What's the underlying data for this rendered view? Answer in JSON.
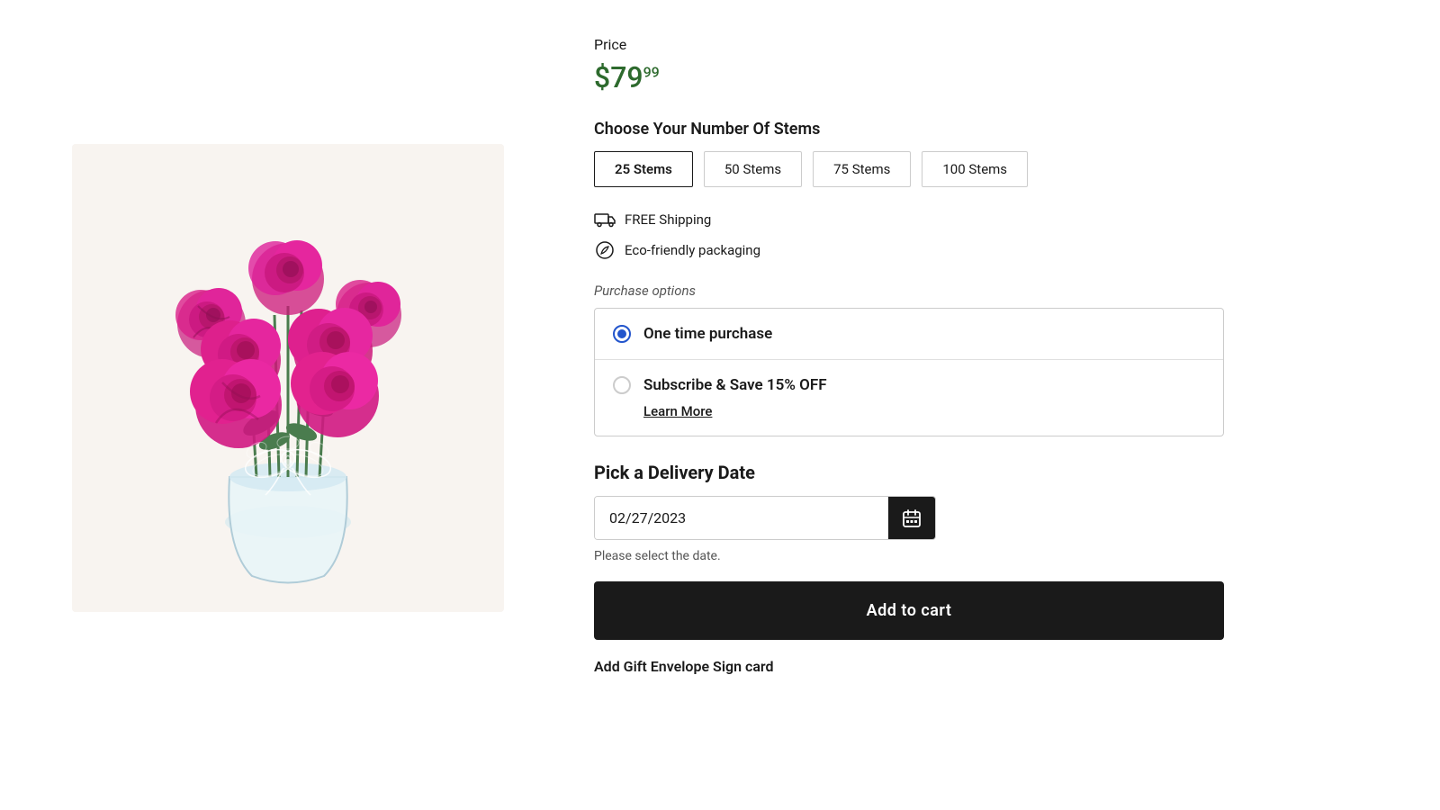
{
  "product": {
    "price_label": "Price",
    "price_main": "$79",
    "price_cents": "99",
    "price_color": "#2d6a2d"
  },
  "stems": {
    "section_title": "Choose Your Number Of Stems",
    "options": [
      {
        "label": "25 Stems",
        "selected": true
      },
      {
        "label": "50 Stems",
        "selected": false
      },
      {
        "label": "75 Stems",
        "selected": false
      },
      {
        "label": "100 Stems",
        "selected": false
      }
    ]
  },
  "perks": [
    {
      "icon": "🚚",
      "text": "FREE Shipping"
    },
    {
      "icon": "♻️",
      "text": "Eco-friendly packaging"
    }
  ],
  "purchase_options": {
    "label": "Purchase options",
    "options": [
      {
        "label": "One time purchase",
        "selected": true
      },
      {
        "label": "Subscribe & Save 15% OFF",
        "selected": false
      }
    ],
    "learn_more_label": "Learn More"
  },
  "delivery": {
    "title": "Pick a Delivery Date",
    "date_value": "02/27/2023",
    "helper_text": "Please select the date.",
    "calendar_icon": "📅"
  },
  "cart": {
    "add_to_cart_label": "Add to cart",
    "bottom_hint": "Add Gift Envelope Sign card"
  }
}
